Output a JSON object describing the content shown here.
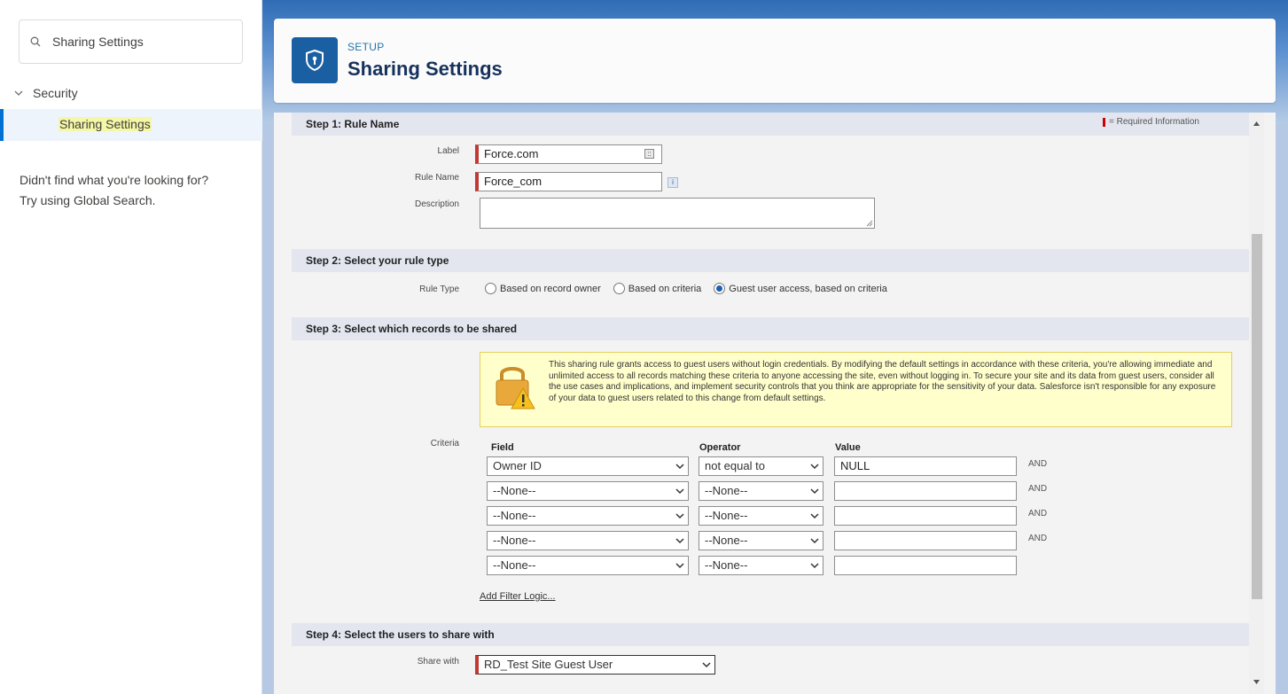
{
  "sidebar": {
    "search_text": "Sharing Settings",
    "tree_parent": "Security",
    "tree_child": "Sharing Settings",
    "help_line1": "Didn't find what you're looking for?",
    "help_line2": "Try using Global Search."
  },
  "header": {
    "eyebrow": "SETUP",
    "title": "Sharing Settings",
    "icon": "shield-icon"
  },
  "step1": {
    "title": "Step 1: Rule Name",
    "required_info": "= Required Information",
    "label_label": "Label",
    "label_value": "Force.com",
    "rule_name_label": "Rule Name",
    "rule_name_value": "Force_com",
    "info_glyph": "i",
    "description_label": "Description",
    "description_value": ""
  },
  "step2": {
    "title": "Step 2: Select your rule type",
    "rule_type_label": "Rule Type",
    "options": [
      {
        "label": "Based on record owner",
        "checked": false
      },
      {
        "label": "Based on criteria",
        "checked": false
      },
      {
        "label": "Guest user access, based on criteria",
        "checked": true
      }
    ]
  },
  "step3": {
    "title": "Step 3: Select which records to be shared",
    "warning": "This sharing rule grants access to guest users without login credentials. By modifying the default settings in accordance with these criteria, you're allowing immediate and unlimited access to all records matching these criteria to anyone accessing the site, even without logging in. To secure your site and its data from guest users, consider all the use cases and implications, and implement security controls that you think are appropriate for the sensitivity of your data. Salesforce isn't responsible for any exposure of your data to guest users related to this change from default settings.",
    "criteria_label": "Criteria",
    "col_field": "Field",
    "col_operator": "Operator",
    "col_value": "Value",
    "rows": [
      {
        "field": "Owner ID",
        "operator": "not equal to",
        "value": "NULL",
        "conj": "AND"
      },
      {
        "field": "--None--",
        "operator": "--None--",
        "value": "",
        "conj": "AND"
      },
      {
        "field": "--None--",
        "operator": "--None--",
        "value": "",
        "conj": "AND"
      },
      {
        "field": "--None--",
        "operator": "--None--",
        "value": "",
        "conj": "AND"
      },
      {
        "field": "--None--",
        "operator": "--None--",
        "value": "",
        "conj": ""
      }
    ],
    "add_filter_logic": "Add Filter Logic..."
  },
  "step4": {
    "title": "Step 4: Select the users to share with",
    "share_with_label": "Share with",
    "share_with_value": "RD_Test Site Guest User"
  },
  "colors": {
    "accent": "#0070d2",
    "header_icon_bg": "#1b5fa3",
    "required": "#c23934",
    "warning_bg": "#ffffcc"
  }
}
